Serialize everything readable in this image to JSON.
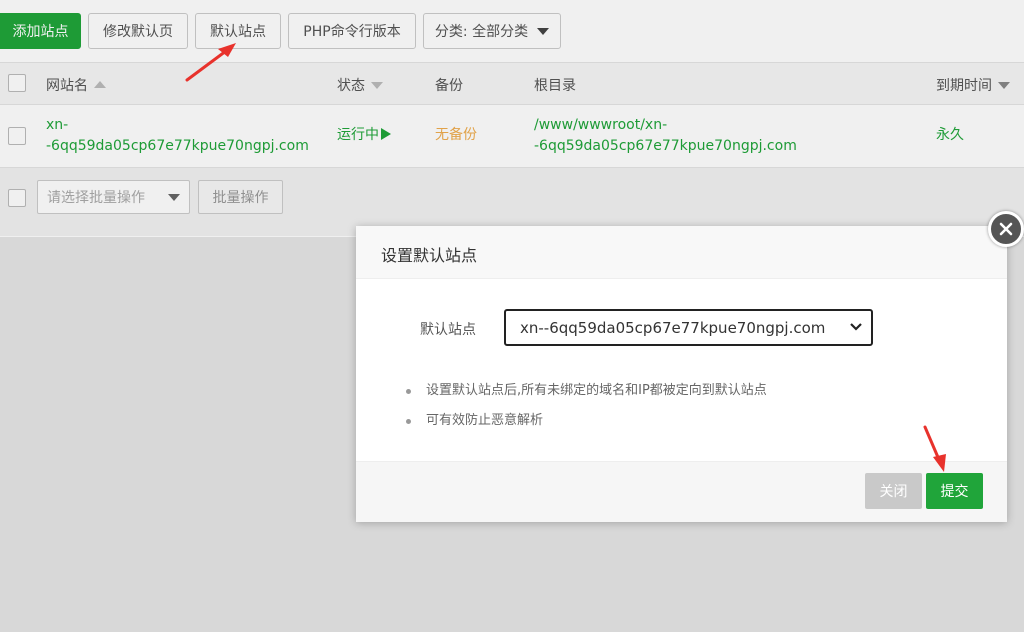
{
  "toolbar": {
    "add_site": "添加站点",
    "modify_default_page": "修改默认页",
    "default_site": "默认站点",
    "php_cli_version": "PHP命令行版本",
    "category_select": "分类: 全部分类"
  },
  "table": {
    "headers": {
      "site_name": "网站名",
      "status": "状态",
      "backup": "备份",
      "root_dir": "根目录",
      "expire": "到期时间"
    },
    "rows": [
      {
        "site_name_line1": "xn-",
        "site_name_line2": "-6qq59da05cp67e77kpue70ngpj.com",
        "status": "运行中",
        "backup": "无备份",
        "root_dir_line1": "/www/wwwroot/xn-",
        "root_dir_line2": "-6qq59da05cp67e77kpue70ngpj.com",
        "expire": "永久"
      }
    ],
    "batch_select_placeholder": "请选择批量操作",
    "batch_button": "批量操作"
  },
  "dialog": {
    "title": "设置默认站点",
    "field_label": "默认站点",
    "selected_site": "xn--6qq59da05cp67e77kpue70ngpj.com",
    "tips": [
      "设置默认站点后,所有未绑定的域名和IP都被定向到默认站点",
      "可有效防止恶意解析"
    ],
    "close_button": "关闭",
    "submit_button": "提交"
  },
  "colors": {
    "accent_green": "#20a53a",
    "warning_orange": "#f0ad4e",
    "annotation_red": "#e8322c"
  }
}
